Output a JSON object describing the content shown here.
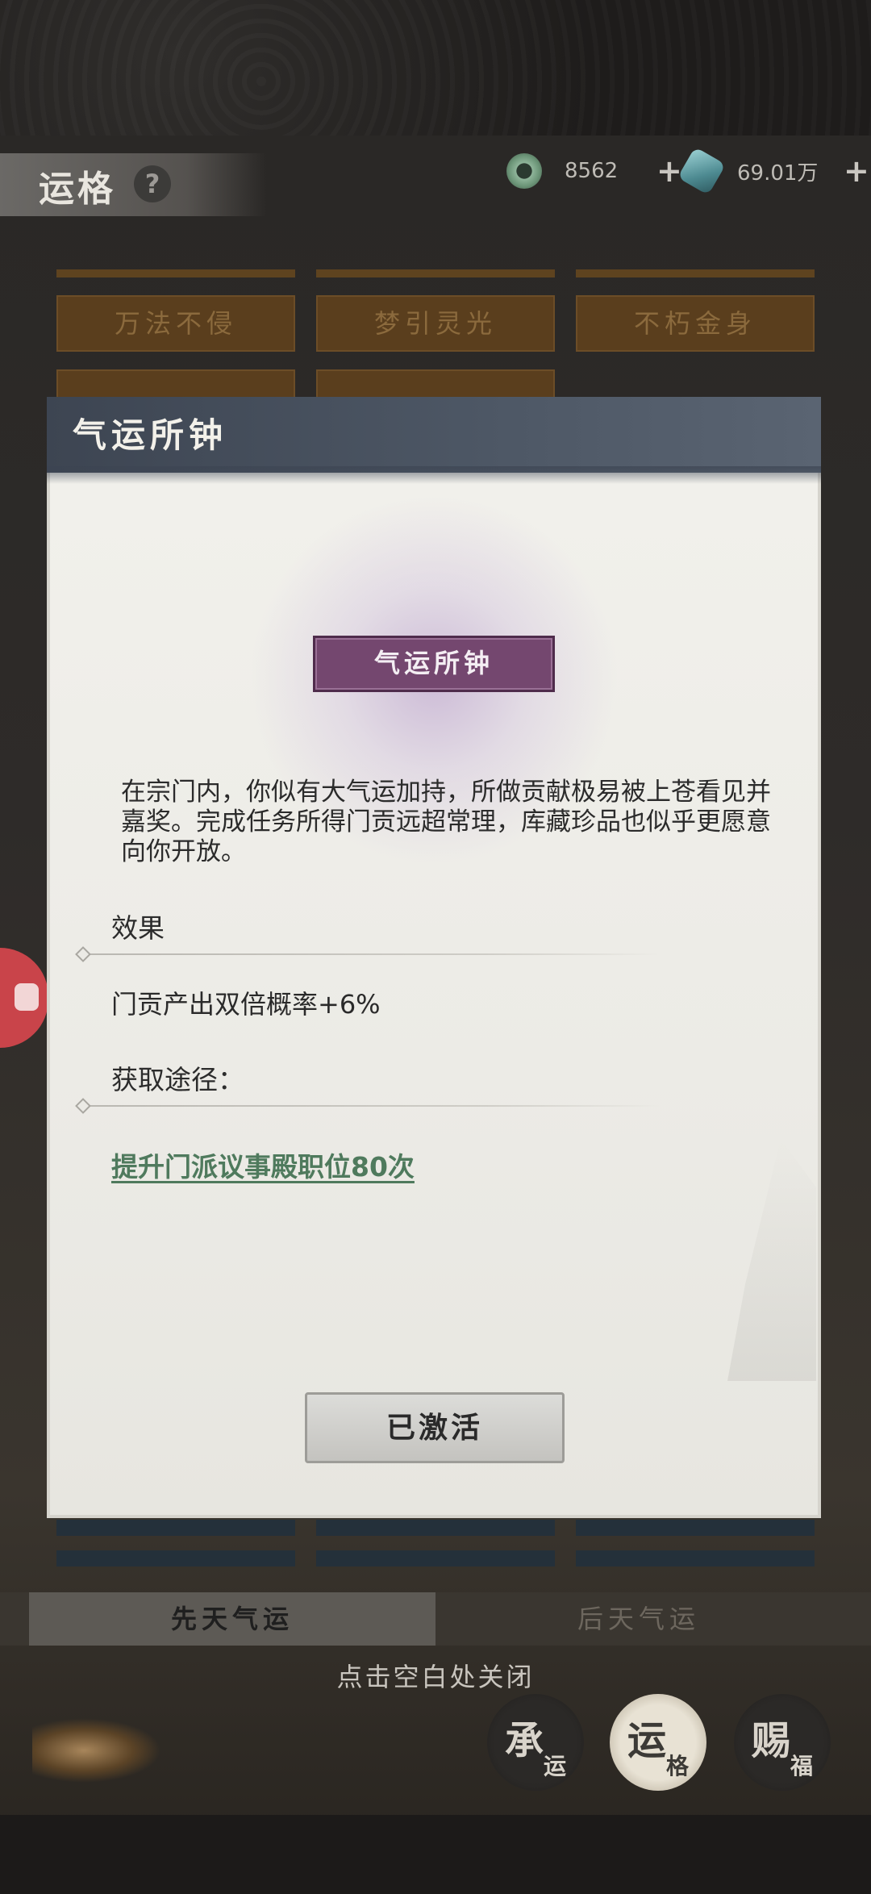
{
  "header": {
    "title": "运格",
    "help_icon": "question-icon",
    "currencies": [
      {
        "icon": "jade-coin-icon",
        "value": "8562",
        "plus": "+"
      },
      {
        "icon": "spirit-crystal-icon",
        "value": "69.01万",
        "plus": "+"
      }
    ]
  },
  "background_tiles": [
    "万法不侵",
    "梦引灵光",
    "不朽金身"
  ],
  "modal": {
    "title": "气运所钟",
    "item_name": "气运所钟",
    "description": "在宗门内，你似有大气运加持，所做贡献极易被上苍看见并嘉奖。完成任务所得门贡远超常理，库藏珍品也似乎更愿意向你开放。",
    "effect_label": "效果",
    "effect_text": "门贡产出双倍概率+6%",
    "acquire_label": "获取途径：",
    "acquire_link": "提升门派议事殿职位80次",
    "button_label": "已激活"
  },
  "tabs": [
    {
      "label": "先天气运",
      "active": true
    },
    {
      "label": "后天气运",
      "active": false
    }
  ],
  "close_hint": "点击空白处关闭",
  "nav": [
    {
      "big": "承",
      "small": "运"
    },
    {
      "big": "运",
      "small": "格"
    },
    {
      "big": "赐",
      "small": "福"
    }
  ],
  "colors": {
    "accent_purple": "#74476f",
    "link_green": "#4f7a5d",
    "modal_header": "#4e5866",
    "tile_brown": "#5a3e1d"
  }
}
